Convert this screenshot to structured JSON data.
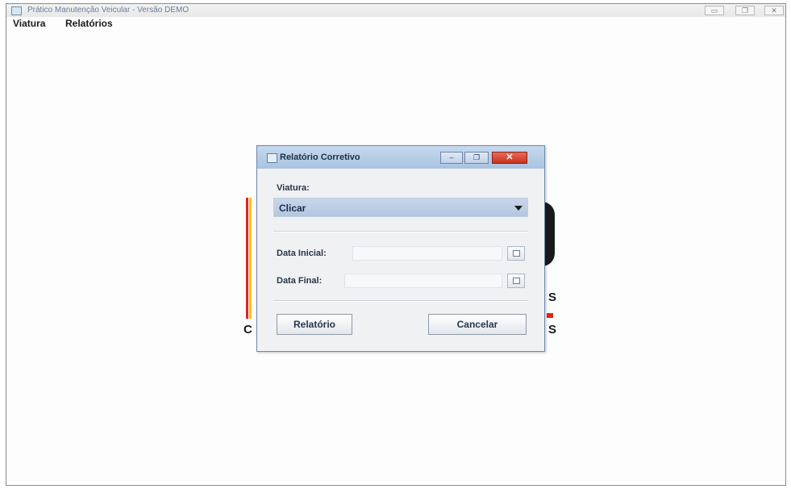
{
  "app": {
    "title": "Prático Manutenção Veicular - Versão DEMO",
    "window_controls": {
      "minimize": "▭",
      "maximize": "❐",
      "close": "✕"
    }
  },
  "menubar": {
    "items": [
      {
        "label": "Viatura"
      },
      {
        "label": "Relatórios"
      }
    ]
  },
  "background_logo": {
    "letters": [
      "C",
      "S",
      "S"
    ],
    "colors": {
      "red": "#e2231a",
      "yellow": "#f2c500",
      "dark": "#1a1a1a"
    }
  },
  "dialog": {
    "title": "Relatório Corretivo",
    "controls": {
      "minimize": "–",
      "maximize": "❐",
      "close": "✕"
    },
    "viatura": {
      "label": "Viatura:",
      "selected": "Clicar"
    },
    "data_inicial": {
      "label": "Data Inicial:",
      "value": ""
    },
    "data_final": {
      "label": "Data Final:",
      "value": ""
    },
    "buttons": {
      "relatorio": "Relatório",
      "cancelar": "Cancelar"
    }
  },
  "icons": {
    "app": "window-icon",
    "calendar": "calendar-icon",
    "combo_arrow": "chevron-down-icon"
  }
}
